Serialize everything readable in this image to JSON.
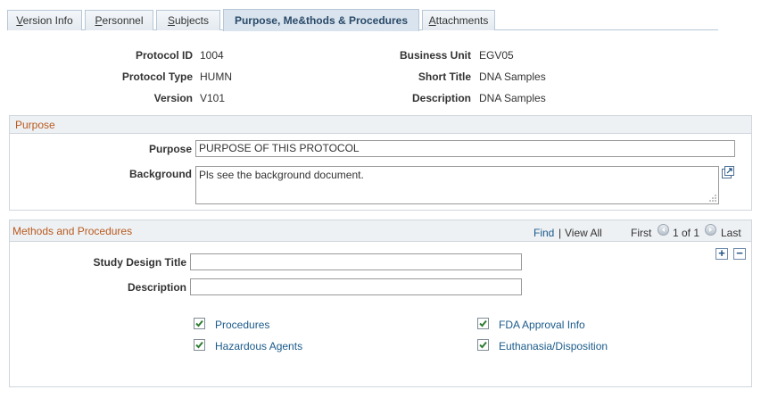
{
  "tabs": [
    {
      "label_pre": "",
      "label_u": "V",
      "label_post": "ersion Info"
    },
    {
      "label_pre": "",
      "label_u": "P",
      "label_post": "ersonnel"
    },
    {
      "label_pre": "",
      "label_u": "S",
      "label_post": "ubjects"
    },
    {
      "label": "Purpose, Me&thods & Procedures"
    },
    {
      "label_pre": "",
      "label_u": "A",
      "label_post": "ttachments"
    }
  ],
  "header": {
    "protocol_id_label": "Protocol ID",
    "protocol_id": "1004",
    "protocol_type_label": "Protocol Type",
    "protocol_type": "HUMN",
    "version_label": "Version",
    "version": "V101",
    "business_unit_label": "Business Unit",
    "business_unit": "EGV05",
    "short_title_label": "Short Title",
    "short_title": "DNA Samples",
    "description_label": "Description",
    "description": "DNA Samples"
  },
  "purpose": {
    "section_title": "Purpose",
    "purpose_label": "Purpose",
    "purpose_value": "PURPOSE OF THIS PROTOCOL",
    "background_label": "Background",
    "background_value": "Pls see the background document."
  },
  "methods": {
    "section_title": "Methods and Procedures",
    "find": "Find",
    "separator": "|",
    "view_all": "View All",
    "first": "First",
    "range": "1 of 1",
    "last": "Last",
    "add_symbol": "+",
    "delete_symbol": "−",
    "study_design_label": "Study Design Title",
    "study_design_value": "",
    "description_label": "Description",
    "description_value": "",
    "checkboxes": [
      {
        "label": "Procedures",
        "checked": true
      },
      {
        "label": "Hazardous Agents",
        "checked": true
      },
      {
        "label": "FDA Approval Info",
        "checked": true
      },
      {
        "label": "Euthanasia/Disposition",
        "checked": true
      }
    ]
  },
  "colors": {
    "section_title": "#b85a1e",
    "link": "#1a5a8a",
    "check": "#2e7d32"
  }
}
